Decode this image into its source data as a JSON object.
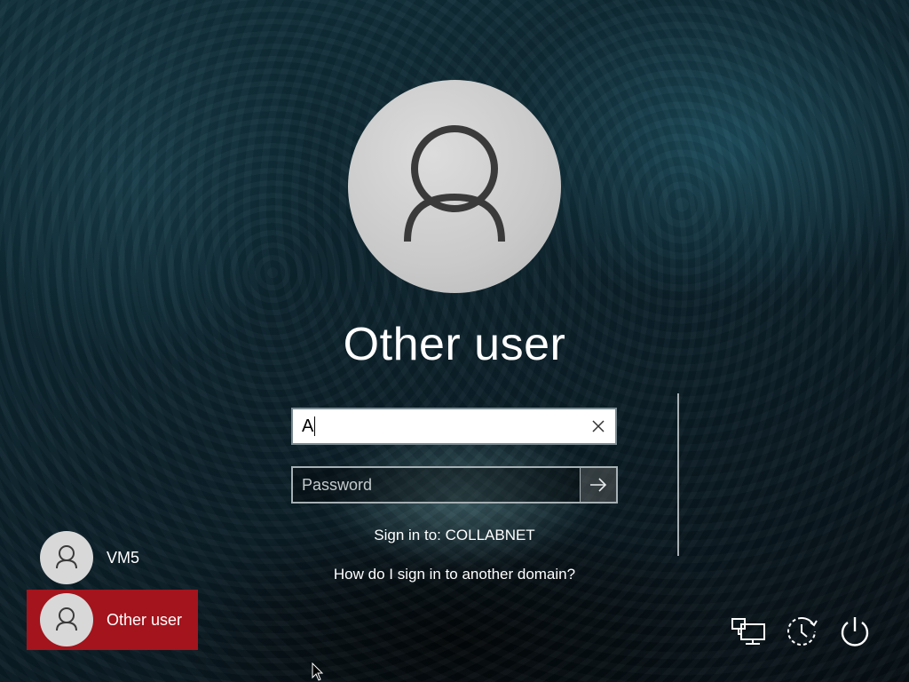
{
  "login": {
    "display_name": "Other user",
    "username_value": "A",
    "password_placeholder": "Password",
    "sign_in_to": "Sign in to: COLLABNET",
    "other_domain_link": "How do I sign in to another domain?"
  },
  "user_list": [
    {
      "name": "VM5",
      "selected": false
    },
    {
      "name": "Other user",
      "selected": true
    }
  ],
  "icons": {
    "clear": "close-icon",
    "submit": "arrow-right-icon",
    "network": "network-icon",
    "accessibility": "ease-of-access-icon",
    "power": "power-icon"
  },
  "colors": {
    "selected_tile": "#a3141c",
    "text": "#ffffff"
  }
}
